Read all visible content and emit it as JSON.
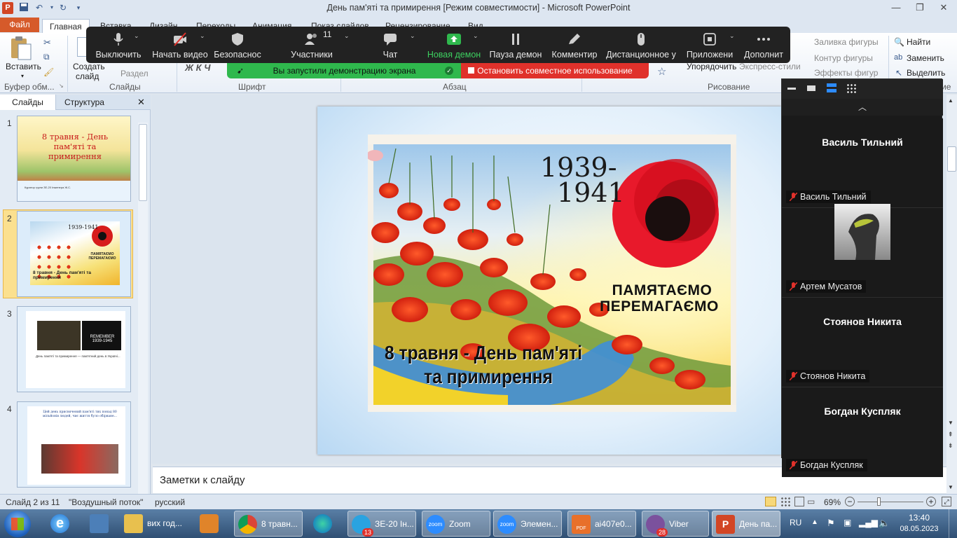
{
  "window": {
    "title": "День пам'яті та примирення [Режим совместимости]  -  Microsoft PowerPoint",
    "app_icon": "P"
  },
  "tabs": {
    "file": "Файл",
    "home": "Главная",
    "insert": "Вставка",
    "design": "Дизайн",
    "transitions": "Переходы",
    "animation": "Анимация",
    "slideshow": "Показ слайдов",
    "review": "Рецензирование",
    "view": "Вид"
  },
  "ribbon": {
    "paste": "Вставить",
    "new_slide": "Создать\nслайд",
    "new_slide_l1": "Создать",
    "new_slide_l2": "слайд",
    "section": "Раздел",
    "clipboard_group": "Буфер обм...",
    "slides_group": "Слайды",
    "font_group": "Шрифт",
    "paragraph_group": "Абзац",
    "drawing_group": "Рисование",
    "arrange": "Упорядочить",
    "quick_styles": "Экспресс-стили",
    "shape_fill": "Заливка фигуры",
    "shape_outline": "Контур фигуры",
    "shape_effects": "Эффекты фигур",
    "find": "Найти",
    "replace": "Заменить",
    "select": "Выделить",
    "edit_group_partial": "ие"
  },
  "zoom_toolbar": {
    "mute": "Выключить",
    "start_video": "Начать видео",
    "security": "Безопаснос",
    "participants": "Участники",
    "participants_count": "11",
    "chat": "Чат",
    "new_share": "Новая демон",
    "pause_share": "Пауза демон",
    "annotate": "Комментир",
    "remote_control": "Дистанционное у",
    "apps": "Приложени",
    "more": "Дополнит",
    "share_banner": "Вы запустили демонстрацию экрана",
    "stop_share": "Остановить совместное использование"
  },
  "slide_panel": {
    "tab_slides": "Слайды",
    "tab_outline": "Структура",
    "thumbs": [
      {
        "num": "1",
        "title": "8 травня - День пам'яті та примирення",
        "footer": "Куратор групи ЗЕ-20 Інженера Ж.С."
      },
      {
        "num": "2",
        "year": "1939-1941",
        "slogan": "ПАМЯТАЄМО ПЕРЕМАГАЄМО",
        "title": "8 травня - День пам'яті та примирення"
      },
      {
        "num": "3",
        "remember": "REMEMBER 1939-1945",
        "text": "День пам'яті та примирення — пам'ятний день в Україні..."
      },
      {
        "num": "4",
        "text": "Цей день присвячений пам'яті тих понад 80 мільйонів людей, чиє життя було обірване..."
      }
    ]
  },
  "slide": {
    "years": "1939-\n1941",
    "years_l1": "1939-",
    "years_l2": "1941",
    "slogan_l1": "ПАМЯТАЄМО",
    "slogan_l2": "ПЕРЕМАГАЄМО",
    "title_l1": "8 травня - День пам'яті",
    "title_l2": "та примирення"
  },
  "notes": {
    "placeholder": "Заметки к слайду"
  },
  "zoom_panel": {
    "participants": [
      {
        "big_name": "Василь Тильний",
        "tag": "Василь Тильний",
        "has_avatar": false
      },
      {
        "big_name": "",
        "tag": "Артем Мусатов",
        "has_avatar": true
      },
      {
        "big_name": "Стоянов Никита",
        "tag": "Стоянов Никита",
        "has_avatar": false
      },
      {
        "big_name": "Богдан Куспляк",
        "tag": "Богдан Куспляк",
        "has_avatar": false
      }
    ]
  },
  "statusbar": {
    "slide_info": "Слайд 2 из 11",
    "theme": "\"Воздушный поток\"",
    "language": "русский",
    "zoom": "69%"
  },
  "taskbar": {
    "items": [
      {
        "label": "вих год...",
        "icon": "folder-icon"
      },
      {
        "label": "8 травн...",
        "icon": "chrome-icon"
      },
      {
        "label": "ЗЕ-20 Ін...",
        "icon": "telegram-icon",
        "badge": "13"
      },
      {
        "label": "Zoom",
        "icon": "zoom-icon"
      },
      {
        "label": "Элемен...",
        "icon": "zoom-icon"
      },
      {
        "label": "ai407e0...",
        "icon": "pdf-icon"
      },
      {
        "label": "Viber",
        "icon": "viber-icon",
        "badge": "28"
      },
      {
        "label": "День па...",
        "icon": "powerpoint-icon"
      }
    ],
    "lang": "RU",
    "time": "13:40",
    "date": "08.05.2023"
  },
  "colors": {
    "zoom_green": "#2fb84d",
    "zoom_red": "#e0312b",
    "ppt_orange": "#d65a2a"
  }
}
